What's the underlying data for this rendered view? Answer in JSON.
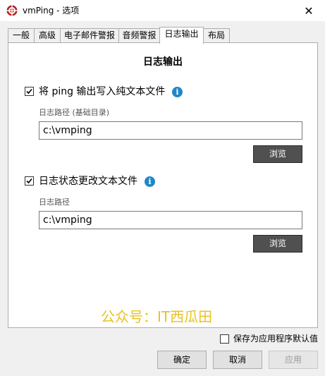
{
  "window": {
    "title": "vmPing - 选项",
    "close_symbol": "✕"
  },
  "tabs": [
    {
      "label": "一般",
      "active": false
    },
    {
      "label": "高级",
      "active": false
    },
    {
      "label": "电子邮件警报",
      "active": false
    },
    {
      "label": "音频警报",
      "active": false
    },
    {
      "label": "日志输出",
      "active": true
    },
    {
      "label": "布局",
      "active": false
    }
  ],
  "log_output": {
    "section_title": "日志输出",
    "ping_log": {
      "checked": true,
      "label": "将 ping 输出写入纯文本文件",
      "path_label": "日志路径 (基础目录)",
      "path_value": "c:\\vmping",
      "browse_label": "浏览"
    },
    "status_log": {
      "checked": true,
      "label": "日志状态更改文本文件",
      "path_label": "日志路径",
      "path_value": "c:\\vmping",
      "browse_label": "浏览"
    },
    "info_icon_glyph": "i"
  },
  "watermark": "公众号：IT西瓜田",
  "footer": {
    "save_default_label": "保存为应用程序默认值",
    "save_default_checked": false,
    "ok_label": "确定",
    "cancel_label": "取消",
    "apply_label": "应用"
  },
  "colors": {
    "info_icon": "#1e88c7",
    "dark_button": "#505050",
    "watermark": "#e8c322"
  }
}
